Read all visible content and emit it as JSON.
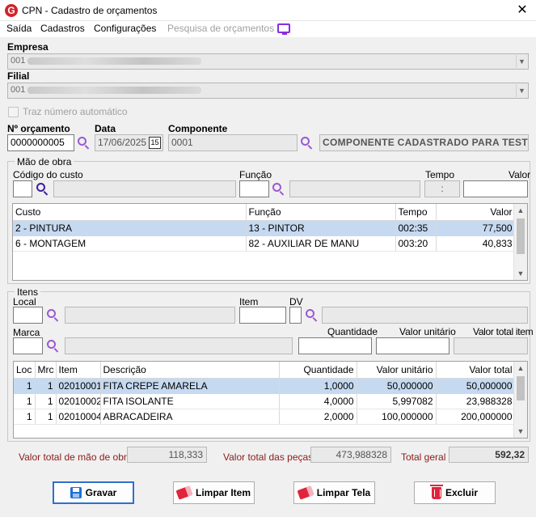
{
  "window": {
    "title": "CPN - Cadastro de orçamentos",
    "close": "✕"
  },
  "menu": {
    "items": [
      "Saída",
      "Cadastros",
      "Configurações",
      "Pesquisa de orçamentos"
    ]
  },
  "empresa": {
    "label": "Empresa",
    "value": "001"
  },
  "filial": {
    "label": "Filial",
    "value": "001"
  },
  "auto_number": {
    "label": "Traz número automático"
  },
  "orcamento": {
    "label": "Nº orçamento",
    "value": "0000000005"
  },
  "data": {
    "label": "Data",
    "value": "17/06/2025",
    "cal": "15"
  },
  "componente": {
    "label": "Componente",
    "value": "0001",
    "description": "COMPONENTE CADASTRADO PARA TESTE"
  },
  "mao_obra": {
    "title": "Mão de obra",
    "labels": {
      "codigo": "Código do custo",
      "funcao": "Função",
      "tempo": "Tempo",
      "valor": "Valor"
    },
    "tempo_value": ":",
    "columns": [
      "Custo",
      "Função",
      "Tempo",
      "Valor"
    ],
    "rows": [
      [
        "2 - PINTURA",
        "13 - PINTOR",
        "002:35",
        "77,500"
      ],
      [
        "6 - MONTAGEM",
        "82 - AUXILIAR DE MANU",
        "003:20",
        "40,833"
      ]
    ]
  },
  "itens": {
    "title": "Itens",
    "labels": {
      "local": "Local",
      "item": "Item",
      "dv": "DV",
      "marca": "Marca",
      "quantidade": "Quantidade",
      "valor_unitario": "Valor unitário",
      "valor_total": "Valor total item"
    },
    "columns": [
      "Loc",
      "Mrc",
      "Item",
      "Descrição",
      "Quantidade",
      "Valor unitário",
      "Valor total"
    ],
    "rows": [
      [
        "1",
        "1",
        "02010001",
        "FITA CREPE AMARELA",
        "1,0000",
        "50,000000",
        "50,000000"
      ],
      [
        "1",
        "1",
        "02010002",
        "FITA ISOLANTE",
        "4,0000",
        "5,997082",
        "23,988328"
      ],
      [
        "1",
        "1",
        "02010004",
        "ABRACADEIRA",
        "2,0000",
        "100,000000",
        "200,000000"
      ]
    ]
  },
  "totals": {
    "mao_obra_label": "Valor total de mão de obra",
    "mao_obra_value": "118,333",
    "pecas_label": "Valor total das peças",
    "pecas_value": "473,988328",
    "geral_label": "Total geral",
    "geral_value": "592,32"
  },
  "buttons": {
    "gravar": "Gravar",
    "limpar_item": "Limpar Item",
    "limpar_tela": "Limpar Tela",
    "excluir": "Excluir"
  },
  "colors": {
    "selection": "#c5d9f1",
    "accent_purple": "#9b59d0",
    "brand_red": "#d2232a",
    "total_label": "#8b1a1a"
  }
}
